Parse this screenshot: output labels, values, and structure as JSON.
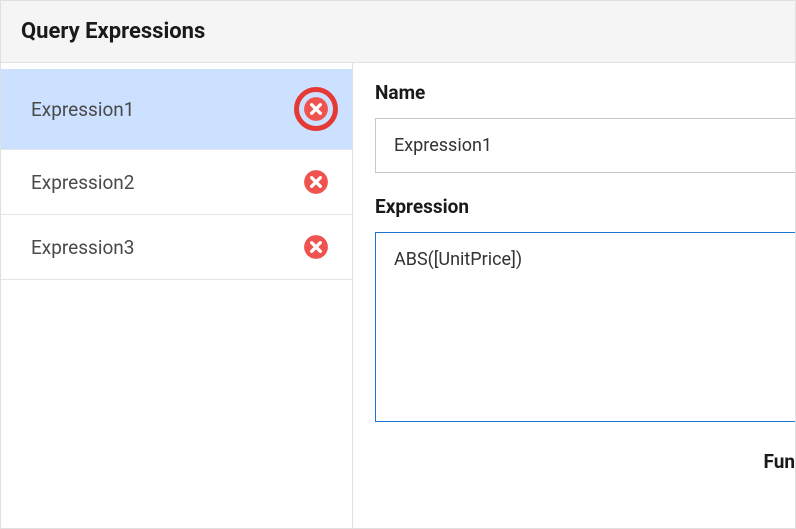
{
  "header": {
    "title": "Query Expressions"
  },
  "sidebar": {
    "items": [
      {
        "label": "Expression1",
        "selected": true,
        "highlighted": true
      },
      {
        "label": "Expression2",
        "selected": false,
        "highlighted": false
      },
      {
        "label": "Expression3",
        "selected": false,
        "highlighted": false
      }
    ]
  },
  "main": {
    "name_label": "Name",
    "name_value": "Expression1",
    "expression_label": "Expression",
    "expression_value": "ABS([UnitPrice])",
    "functions_label": "Fun"
  }
}
